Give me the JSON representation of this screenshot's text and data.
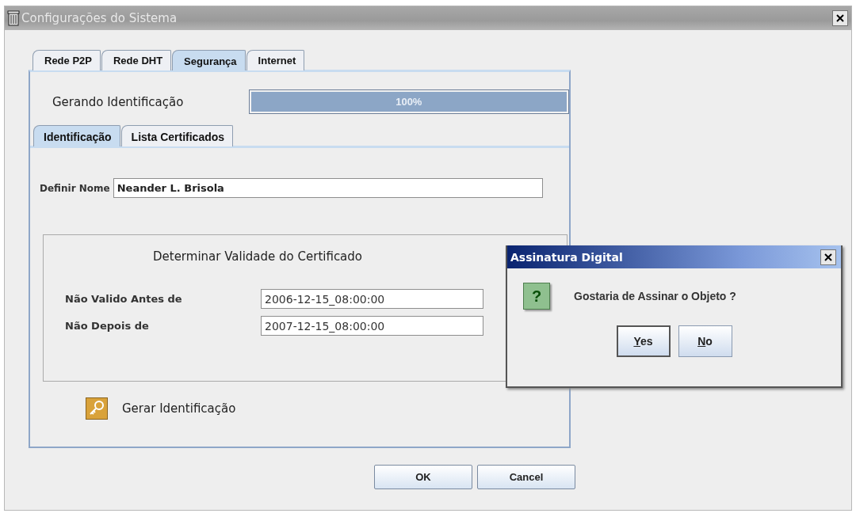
{
  "window": {
    "title": "Configurações do Sistema"
  },
  "tabs": [
    {
      "label": "Rede P2P",
      "selected": false
    },
    {
      "label": "Rede DHT",
      "selected": false
    },
    {
      "label": "Segurança",
      "selected": true
    },
    {
      "label": "Internet",
      "selected": false
    }
  ],
  "progress": {
    "label": "Gerando Identificação",
    "level": 1,
    "reading": "100%"
  },
  "sub_tabs": [
    {
      "label": "Identificação",
      "selected": true
    },
    {
      "label": "Lista Certificados",
      "selected": false
    }
  ],
  "name_field": {
    "label": "Definir Nome",
    "value": "Neander L. Brisola"
  },
  "validity": {
    "title": "Determinar Validade do Certificado",
    "fields": [
      {
        "label": "Não Valido Antes de",
        "value": "2006-12-15_08:00:00"
      },
      {
        "label": "Não Depois de",
        "value": "2007-12-15_08:00:00"
      }
    ]
  },
  "generate_button": {
    "label": "Gerar Identificação"
  },
  "buttons": [
    "OK",
    "Cancel"
  ],
  "dialog": {
    "title": "Assinatura Digital",
    "icon": "?",
    "message": "Gostaria de Assinar o Objeto ?",
    "buttons": [
      {
        "label": "Yes",
        "selected": true
      },
      {
        "label": "No",
        "selected": false
      }
    ]
  }
}
